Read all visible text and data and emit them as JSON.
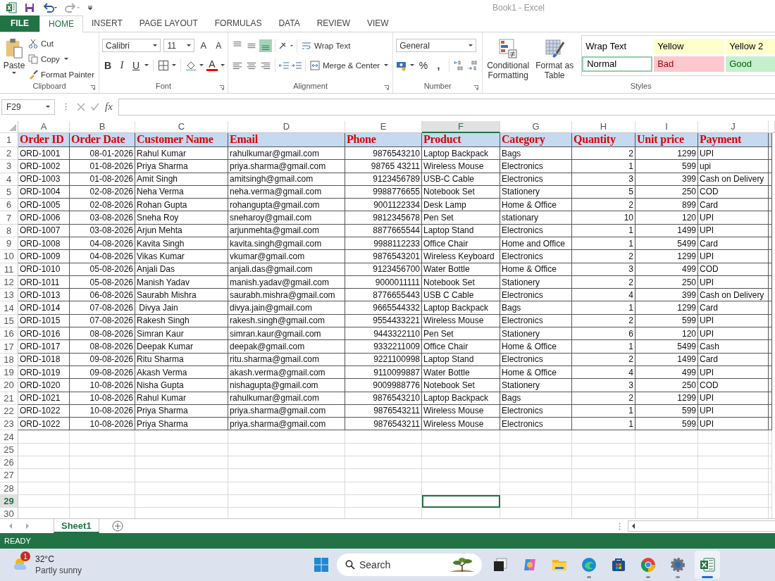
{
  "window": {
    "title": "Book1 - Excel"
  },
  "ribbon_tabs": [
    {
      "label": "FILE",
      "kind": "file",
      "selected": false
    },
    {
      "label": "HOME",
      "kind": "tab",
      "selected": true
    },
    {
      "label": "INSERT",
      "kind": "tab",
      "selected": false
    },
    {
      "label": "PAGE LAYOUT",
      "kind": "tab",
      "selected": false
    },
    {
      "label": "FORMULAS",
      "kind": "tab",
      "selected": false
    },
    {
      "label": "DATA",
      "kind": "tab",
      "selected": false
    },
    {
      "label": "REVIEW",
      "kind": "tab",
      "selected": false
    },
    {
      "label": "VIEW",
      "kind": "tab",
      "selected": false
    }
  ],
  "clipboard": {
    "label": "Clipboard",
    "paste": "Paste",
    "cut": "Cut",
    "copy": "Copy",
    "format_painter": "Format Painter"
  },
  "font": {
    "label": "Font",
    "name": "Calibri",
    "size": "11",
    "grow": "A",
    "shrink": "A",
    "bold": "B",
    "italic": "I",
    "underline": "U",
    "font_color": "A"
  },
  "alignment": {
    "label": "Alignment",
    "wrap_text": "Wrap Text",
    "merge": "Merge & Center",
    "vertical_align": [
      {
        "selected": false
      },
      {
        "selected": false
      },
      {
        "selected": true
      }
    ]
  },
  "number": {
    "label": "Number",
    "format": "General",
    "percent": "%",
    "comma": ","
  },
  "styles": {
    "label": "Styles",
    "conditional_formatting": "Conditional Formatting",
    "format_as_table": "Format as Table",
    "gallery": [
      {
        "label": "Wrap Text",
        "kind": "plain",
        "color": "#ffffff",
        "selected": false
      },
      {
        "label": "Yellow",
        "kind": "plain",
        "color": "#ffffcc",
        "selected": false
      },
      {
        "label": "Yellow 2",
        "kind": "plain",
        "color": "#ffffcc",
        "selected": false
      },
      {
        "label": "Normal",
        "kind": "plain",
        "color": "#ffffff",
        "selected": true
      },
      {
        "label": "Bad",
        "kind": "bad",
        "color": "#ffc7ce",
        "selected": false
      },
      {
        "label": "Good",
        "kind": "good",
        "color": "#c6efce",
        "selected": false
      }
    ]
  },
  "formula_bar": {
    "name_box": "F29",
    "fx": "fx"
  },
  "sheet": {
    "columns": [
      {
        "letter": "A",
        "selected": false
      },
      {
        "letter": "B",
        "selected": false
      },
      {
        "letter": "C",
        "selected": false
      },
      {
        "letter": "D",
        "selected": false
      },
      {
        "letter": "E",
        "selected": false
      },
      {
        "letter": "F",
        "selected": true
      },
      {
        "letter": "G",
        "selected": false
      },
      {
        "letter": "H",
        "selected": false
      },
      {
        "letter": "I",
        "selected": false
      },
      {
        "letter": "J",
        "selected": false
      }
    ],
    "header_row": {
      "number": "1",
      "selected": false,
      "cells": [
        "Order ID",
        "Order Date",
        "Customer Name",
        "Email",
        "Phone",
        "Product",
        "Category",
        "Quantity",
        "Unit price",
        "Payment"
      ]
    },
    "rows": [
      {
        "number": "2",
        "selected": false,
        "cells": [
          "ORD-1001",
          "08-01-2026",
          "Rahul Kumar",
          "rahulkumar@gmail.com",
          "9876543210",
          "Laptop Backpack",
          "Bags",
          "2",
          "1299",
          "UPI"
        ]
      },
      {
        "number": "3",
        "selected": false,
        "cells": [
          "ORD-1002",
          "01-08-2026",
          "Priya Sharma",
          "priya.sharma@gmail.com",
          "98765 43211",
          "Wireless Mouse",
          "Electronics",
          "1",
          "599",
          "upi"
        ]
      },
      {
        "number": "4",
        "selected": false,
        "cells": [
          "ORD-1003",
          "01-08-2026",
          "Amit Singh",
          "amitsingh@gmail.com",
          "9123456789",
          "USB-C Cable",
          "Electronics",
          "3",
          "399",
          "Cash on Delivery"
        ]
      },
      {
        "number": "5",
        "selected": false,
        "cells": [
          "ORD-1004",
          "02-08-2026",
          "Neha Verma",
          "neha.verma@gmail.com",
          "9988776655",
          "Notebook Set",
          "Stationery",
          "5",
          "250",
          "COD"
        ]
      },
      {
        "number": "6",
        "selected": false,
        "cells": [
          "ORD-1005",
          "02-08-2026",
          "Rohan Gupta",
          "rohangupta@gmail.com",
          "9001122334",
          "Desk Lamp",
          "Home & Office",
          "2",
          "899",
          "Card"
        ]
      },
      {
        "number": "7",
        "selected": false,
        "cells": [
          "ORD-1006",
          "03-08-2026",
          "Sneha Roy",
          "sneharoy@gmail.com",
          "9812345678",
          "Pen Set",
          "stationary",
          "10",
          "120",
          "UPI"
        ]
      },
      {
        "number": "8",
        "selected": false,
        "cells": [
          "ORD-1007",
          "03-08-2026",
          "Arjun Mehta",
          "arjunmehta@gmail.com",
          "8877665544",
          "Laptop Stand",
          "Electronics",
          "1",
          "1499",
          "UPI"
        ]
      },
      {
        "number": "9",
        "selected": false,
        "cells": [
          "ORD-1008",
          "04-08-2026",
          "Kavita Singh",
          "kavita.singh@gmail.com",
          "9988112233",
          "Office Chair",
          "Home and Office",
          "1",
          "5499",
          "Card"
        ]
      },
      {
        "number": "10",
        "selected": false,
        "cells": [
          "ORD-1009",
          "04-08-2026",
          "Vikas Kumar",
          "vkumar@gmail.com",
          "9876543201",
          "Wireless Keyboard",
          "Electronics",
          "2",
          "1299",
          "UPI"
        ]
      },
      {
        "number": "11",
        "selected": false,
        "cells": [
          "ORD-1010",
          "05-08-2026",
          "Anjali Das",
          "anjali.das@gmail.com",
          "9123456700",
          "Water Bottle",
          "Home & Office",
          "3",
          "499",
          "COD"
        ]
      },
      {
        "number": "12",
        "selected": false,
        "cells": [
          "ORD-1011",
          "05-08-2026",
          "Manish Yadav",
          "manish.yadav@gmail.com",
          "9000011111",
          "Notebook Set",
          "Stationery",
          "2",
          "250",
          "UPI"
        ]
      },
      {
        "number": "13",
        "selected": false,
        "cells": [
          "ORD-1013",
          "06-08-2026",
          "Saurabh Mishra",
          "saurabh.mishra@gmail.com",
          "8776655443",
          "USB C Cable",
          "Electronics",
          "4",
          "399",
          "Cash on Delivery"
        ]
      },
      {
        "number": "14",
        "selected": false,
        "cells": [
          "ORD-1014",
          "07-08-2026",
          " Divya Jain",
          "divya.jain@gmail.com",
          "9665544332",
          "Laptop Backpack",
          "Bags",
          "1",
          "1299",
          "Card"
        ]
      },
      {
        "number": "15",
        "selected": false,
        "cells": [
          "ORD-1015",
          "07-08-2026",
          "Rakesh Singh",
          "rakesh.singh@gmail.com",
          "9554433221",
          "Wireless Mouse",
          "Electronics",
          "2",
          "599",
          "UPI"
        ]
      },
      {
        "number": "16",
        "selected": false,
        "cells": [
          "ORD-1016",
          "08-08-2026",
          "Simran Kaur",
          "simran.kaur@gmail.com",
          "9443322110",
          "Pen Set",
          "Stationery",
          "6",
          "120",
          "UPI"
        ]
      },
      {
        "number": "17",
        "selected": false,
        "cells": [
          "ORD-1017",
          "08-08-2026",
          "Deepak Kumar",
          "deepak@gmail.com",
          "9332211009",
          "Office Chair",
          "Home & Office",
          "1",
          "5499",
          "Cash"
        ]
      },
      {
        "number": "18",
        "selected": false,
        "cells": [
          "ORD-1018",
          "09-08-2026",
          "Ritu Sharma",
          "ritu.sharma@gmail.com",
          "9221100998",
          "Laptop Stand",
          "Electronics",
          "2",
          "1499",
          "Card"
        ]
      },
      {
        "number": "19",
        "selected": false,
        "cells": [
          "ORD-1019",
          "09-08-2026",
          "Akash Verma",
          "akash.verma@gmail.com",
          "9110099887",
          "Water Bottle",
          "Home & Office",
          "4",
          "499",
          "UPI"
        ]
      },
      {
        "number": "20",
        "selected": false,
        "cells": [
          "ORD-1020",
          "10-08-2026",
          "Nisha Gupta",
          "nishagupta@gmail.com",
          "9009988776",
          "Notebook Set",
          "Stationery",
          "3",
          "250",
          "COD"
        ]
      },
      {
        "number": "21",
        "selected": false,
        "cells": [
          "ORD-1021",
          "10-08-2026",
          "Rahul Kumar",
          "rahulkumar@gmail.com",
          "9876543210",
          "Laptop Backpack",
          "Bags",
          "2",
          "1299",
          "UPI"
        ]
      },
      {
        "number": "22",
        "selected": false,
        "cells": [
          "ORD-1022",
          "10-08-2026",
          "Priya Sharma",
          "priya.sharma@gmail.com",
          "9876543211",
          "Wireless Mouse",
          "Electronics",
          "1",
          "599",
          "UPI"
        ]
      },
      {
        "number": "23",
        "selected": false,
        "cells": [
          "ORD-1022",
          "10-08-2026",
          "Priya Sharma",
          "priya.sharma@gmail.com",
          "9876543211",
          "Wireless Mouse",
          "Electronics",
          "1",
          "599",
          "UPI"
        ]
      }
    ],
    "empty_rows": [
      {
        "number": "24",
        "selected": false
      },
      {
        "number": "25",
        "selected": false
      },
      {
        "number": "26",
        "selected": false
      },
      {
        "number": "27",
        "selected": false
      },
      {
        "number": "28",
        "selected": false
      },
      {
        "number": "29",
        "selected": true
      },
      {
        "number": "30",
        "selected": false
      }
    ]
  },
  "sheet_tabs": [
    {
      "label": "Sheet1",
      "selected": true
    }
  ],
  "status_bar": {
    "text": "READY"
  },
  "taskbar": {
    "weather": {
      "badge": "1",
      "temperature": "32°C",
      "condition": "Partly sunny"
    },
    "search": {
      "placeholder": "Search"
    },
    "apps": [
      {
        "kind": "task-view",
        "running": false,
        "selected": false
      },
      {
        "kind": "copilot",
        "running": false,
        "selected": false
      },
      {
        "kind": "explorer",
        "running": false,
        "selected": false
      },
      {
        "kind": "edge",
        "running": true,
        "selected": false
      },
      {
        "kind": "store",
        "running": false,
        "selected": false
      },
      {
        "kind": "chrome",
        "running": true,
        "selected": false
      },
      {
        "kind": "settings",
        "running": true,
        "selected": false
      },
      {
        "kind": "excel",
        "running": true,
        "selected": true
      }
    ]
  }
}
